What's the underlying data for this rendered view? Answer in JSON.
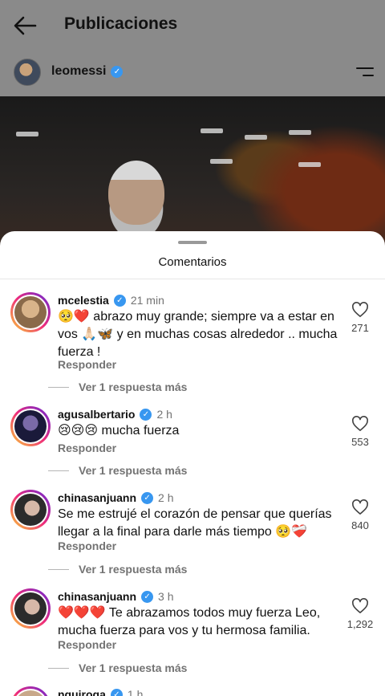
{
  "header": {
    "title": "Publicaciones",
    "username": "leomessi"
  },
  "sheet": {
    "title": "Comentarios"
  },
  "comments": [
    {
      "user": "mcelestia",
      "time": "21 min",
      "text": "🥺❤️ abrazo muy grande; siempre va a estar en vos 🙏🏻🦋 y en muchas cosas alrededor .. mucha fuerza !",
      "likes": "271",
      "reply": "Responder",
      "more": "Ver 1 respuesta más"
    },
    {
      "user": "agusalbertario",
      "time": "2 h",
      "text": "😢😢😢 mucha fuerza",
      "likes": "553",
      "reply": "Responder",
      "more": "Ver 1 respuesta más"
    },
    {
      "user": "chinasanjuann",
      "time": "2 h",
      "text": "Se me estrujé el corazón de pensar que querías llegar a la final para darle más tiempo 🥺❤️‍🩹",
      "likes": "840",
      "reply": "Responder",
      "more": "Ver 1 respuesta más"
    },
    {
      "user": "chinasanjuann",
      "time": "3 h",
      "text": "❤️❤️❤️ Te abrazamos todos muy fuerza Leo, mucha fuerza para vos y tu hermosa familia.",
      "likes": "1,292",
      "reply": "Responder",
      "more": "Ver 1 respuesta más"
    },
    {
      "user": "nquiroga",
      "time": "1 h"
    }
  ],
  "colors": {
    "verified": "#3897f0",
    "ring_start": "#f9ce34",
    "ring_end": "#6228d7"
  }
}
